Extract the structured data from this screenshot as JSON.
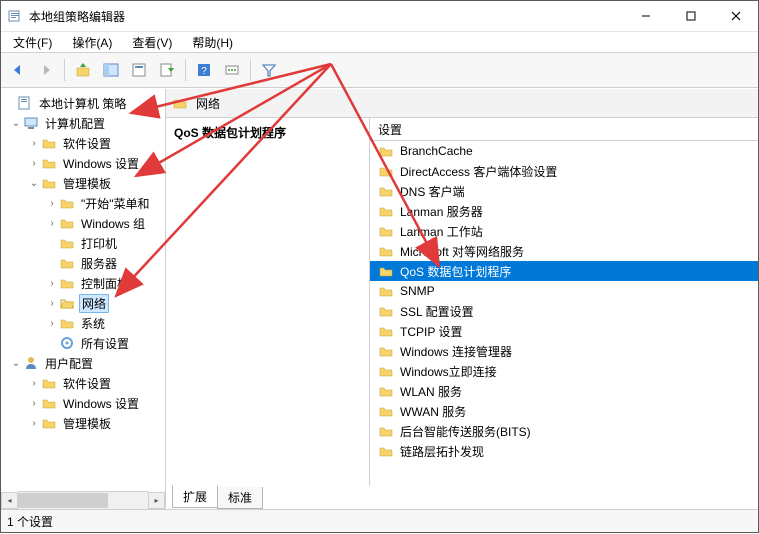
{
  "window": {
    "title": "本地组策略编辑器"
  },
  "menu": {
    "file": "文件(F)",
    "action": "操作(A)",
    "view": "查看(V)",
    "help": "帮助(H)"
  },
  "tree": {
    "root": "本地计算机 策略",
    "computer_config": "计算机配置",
    "software_settings": "软件设置",
    "windows_settings": "Windows 设置",
    "admin_templates": "管理模板",
    "start_menu": "\"开始\"菜单和",
    "windows_components": "Windows 组",
    "printers": "打印机",
    "servers": "服务器",
    "control_panel": "控制面板",
    "network": "网络",
    "system": "系统",
    "all_settings": "所有设置",
    "user_config": "用户配置",
    "u_software_settings": "软件设置",
    "u_windows_settings": "Windows 设置",
    "u_admin_templates": "管理模板"
  },
  "header": {
    "label": "网络"
  },
  "desc": {
    "title": "QoS 数据包计划程序"
  },
  "list_header": {
    "col_setting": "设置"
  },
  "list": {
    "items": [
      "BranchCache",
      "DirectAccess 客户端体验设置",
      "DNS 客户端",
      "Lanman 服务器",
      "Lanman 工作站",
      "Microsoft 对等网络服务",
      "QoS 数据包计划程序",
      "SNMP",
      "SSL 配置设置",
      "TCPIP 设置",
      "Windows 连接管理器",
      "Windows立即连接",
      "WLAN 服务",
      "WWAN 服务",
      "后台智能传送服务(BITS)",
      "链路层拓扑发现"
    ],
    "selected_index": 6
  },
  "tabs": {
    "extended": "扩展",
    "standard": "标准"
  },
  "status": {
    "text": "1 个设置"
  }
}
